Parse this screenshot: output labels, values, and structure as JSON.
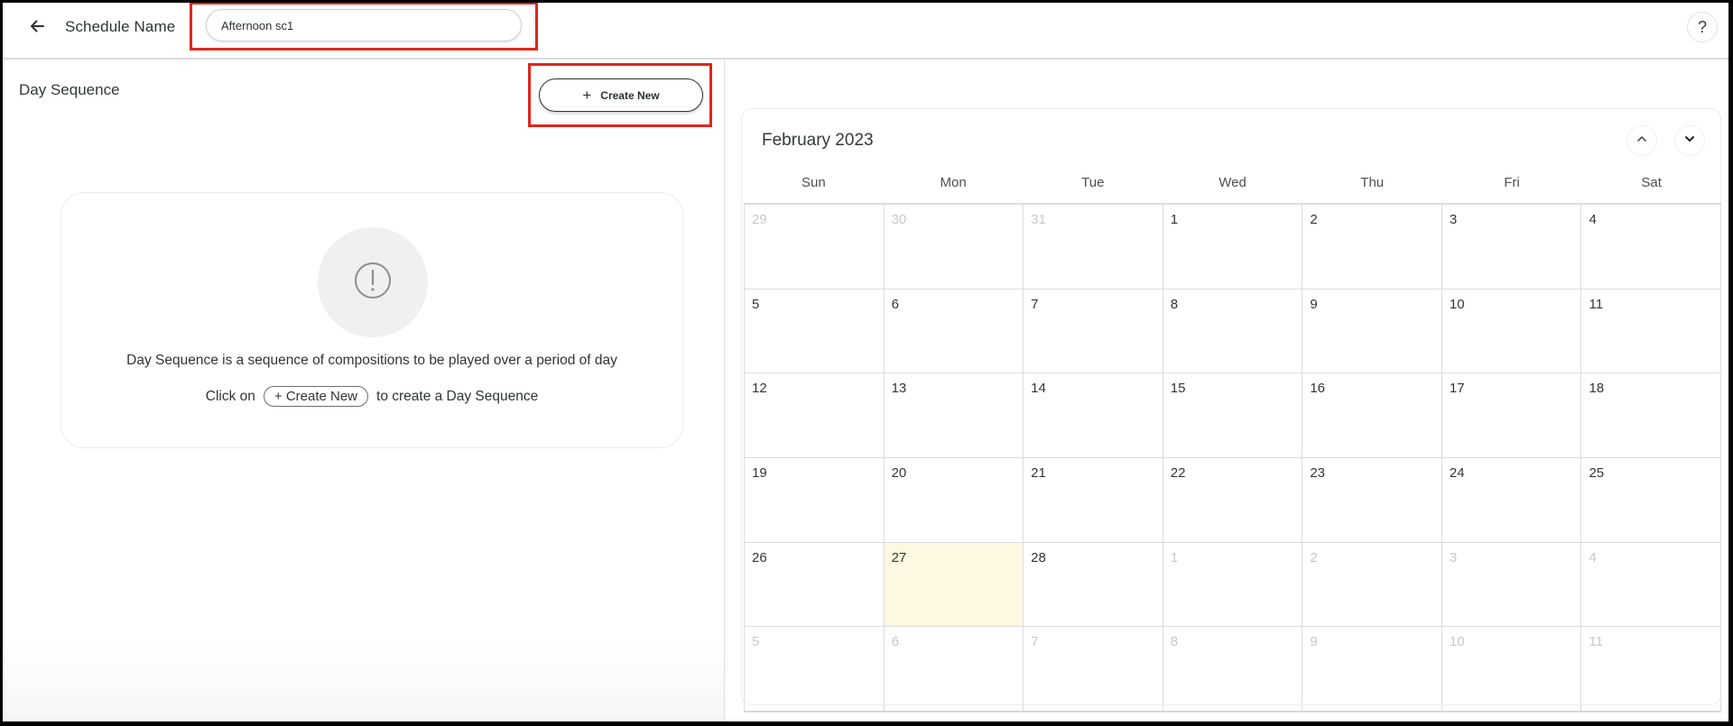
{
  "header": {
    "back_icon": "arrow-left-icon",
    "schedule_name_label": "Schedule Name",
    "schedule_name_value": "Afternoon sc1",
    "help_label": "?"
  },
  "left_panel": {
    "title": "Day Sequence",
    "create_button": {
      "icon": "+",
      "label": "Create New"
    },
    "empty_state": {
      "icon": "exclamation-circle-icon",
      "description": "Day Sequence is a sequence of compositions to be played over a period of day",
      "hint_prefix": "Click on",
      "hint_button": "+ Create New",
      "hint_suffix": "to create a Day Sequence"
    }
  },
  "calendar": {
    "month_label": "February 2023",
    "nav": {
      "prev_icon": "chevron-up-icon",
      "next_icon": "chevron-down-icon"
    },
    "weekdays": [
      "Sun",
      "Mon",
      "Tue",
      "Wed",
      "Thu",
      "Fri",
      "Sat"
    ],
    "highlight_color": "#fdf8e2",
    "weeks": [
      [
        {
          "d": "29",
          "m": true
        },
        {
          "d": "30",
          "m": true
        },
        {
          "d": "31",
          "m": true
        },
        {
          "d": "1"
        },
        {
          "d": "2"
        },
        {
          "d": "3"
        },
        {
          "d": "4"
        }
      ],
      [
        {
          "d": "5"
        },
        {
          "d": "6"
        },
        {
          "d": "7"
        },
        {
          "d": "8"
        },
        {
          "d": "9"
        },
        {
          "d": "10"
        },
        {
          "d": "11"
        }
      ],
      [
        {
          "d": "12"
        },
        {
          "d": "13"
        },
        {
          "d": "14"
        },
        {
          "d": "15"
        },
        {
          "d": "16"
        },
        {
          "d": "17"
        },
        {
          "d": "18"
        }
      ],
      [
        {
          "d": "19"
        },
        {
          "d": "20"
        },
        {
          "d": "21"
        },
        {
          "d": "22"
        },
        {
          "d": "23"
        },
        {
          "d": "24"
        },
        {
          "d": "25"
        }
      ],
      [
        {
          "d": "26"
        },
        {
          "d": "27",
          "today": true
        },
        {
          "d": "28"
        },
        {
          "d": "1",
          "m": true
        },
        {
          "d": "2",
          "m": true
        },
        {
          "d": "3",
          "m": true
        },
        {
          "d": "4",
          "m": true
        }
      ],
      [
        {
          "d": "5",
          "m": true
        },
        {
          "d": "6",
          "m": true
        },
        {
          "d": "7",
          "m": true
        },
        {
          "d": "8",
          "m": true
        },
        {
          "d": "9",
          "m": true
        },
        {
          "d": "10",
          "m": true
        },
        {
          "d": "11",
          "m": true
        }
      ]
    ]
  }
}
